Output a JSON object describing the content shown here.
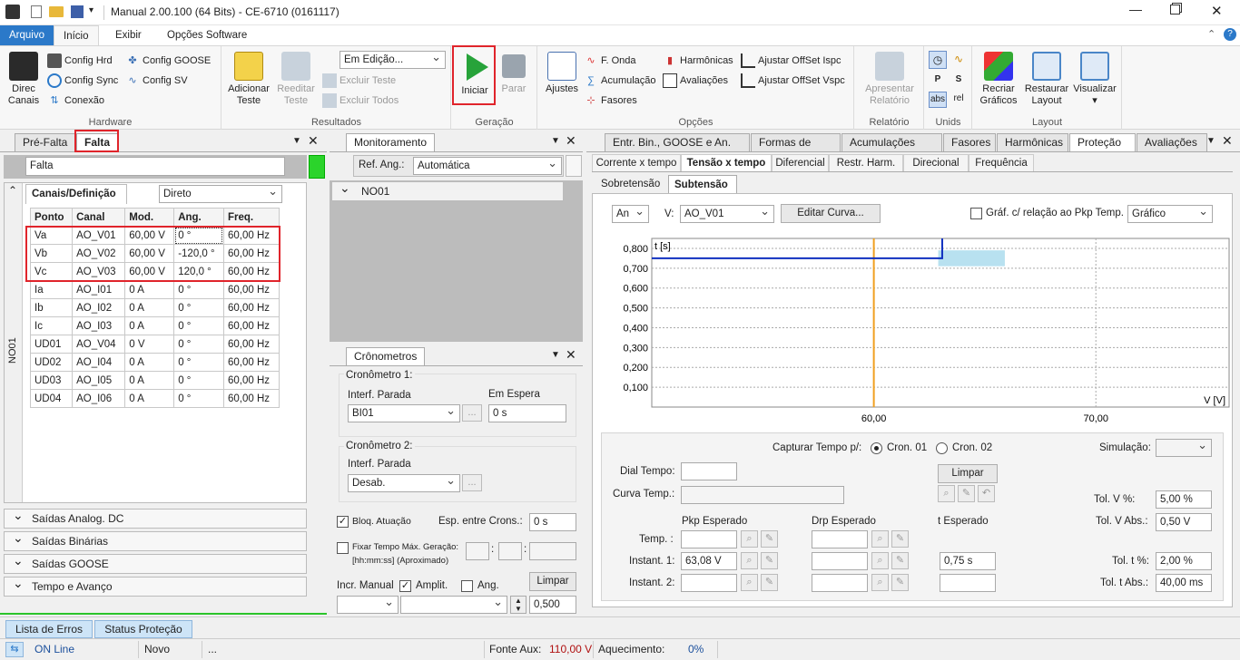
{
  "window": {
    "title": "Manual 2.00.100 (64 Bits) - CE-6710 (0161117)"
  },
  "menu": {
    "tabs": [
      "Arquivo",
      "Início",
      "Exibir",
      "Opções Software"
    ]
  },
  "ribbon": {
    "hardware": {
      "direc_canais": "Direc\nCanais",
      "config_hrd": "Config Hrd",
      "config_sync": "Config Sync",
      "conexao": "Conexão",
      "config_goose": "Config GOOSE",
      "config_sv": "Config SV",
      "label": "Hardware"
    },
    "resultados": {
      "adicionar": "Adicionar\nTeste",
      "reeditar": "Reeditar\nTeste",
      "status": "Em Edição...",
      "excluir_teste": "Excluir Teste",
      "excluir_todos": "Excluir Todos",
      "label": "Resultados"
    },
    "geracao": {
      "iniciar": "Iniciar",
      "parar": "Parar",
      "label": "Geração"
    },
    "opcoes": {
      "ajustes": "Ajustes",
      "f_onda": "F. Onda",
      "acumulacao": "Acumulação",
      "fasores": "Fasores",
      "harmonicas": "Harmônicas",
      "avaliacoes": "Avaliações",
      "offset_ispc": "Ajustar OffSet Ispc",
      "offset_vspc": "Ajustar OffSet Vspc",
      "label": "Opções"
    },
    "relatorio": {
      "apresentar": "Apresentar\nRelatório",
      "label": "Relatório"
    },
    "unids": {
      "abs": "abs",
      "rel": "rel",
      "label": "Unids"
    },
    "layout": {
      "recriar": "Recriar\nGráficos",
      "restaurar": "Restaurar\nLayout",
      "visualizar": "Visualizar",
      "label": "Layout"
    }
  },
  "left": {
    "tabs": [
      "Pré-Falta",
      "Falta"
    ],
    "name_field": "Falta",
    "side_label": "NO01",
    "sub_tab": "Canais/Definição",
    "mode": "Direto",
    "columns": [
      "Ponto",
      "Canal",
      "Mod.",
      "Ang.",
      "Freq."
    ],
    "rows": [
      [
        "Va",
        "AO_V01",
        "60,00 V",
        "0 °",
        "60,00 Hz"
      ],
      [
        "Vb",
        "AO_V02",
        "60,00 V",
        "-120,0 °",
        "60,00 Hz"
      ],
      [
        "Vc",
        "AO_V03",
        "60,00 V",
        "120,0 °",
        "60,00 Hz"
      ],
      [
        "Ia",
        "AO_I01",
        "0 A",
        "0 °",
        "60,00 Hz"
      ],
      [
        "Ib",
        "AO_I02",
        "0 A",
        "0 °",
        "60,00 Hz"
      ],
      [
        "Ic",
        "AO_I03",
        "0 A",
        "0 °",
        "60,00 Hz"
      ],
      [
        "UD01",
        "AO_V04",
        "0 V",
        "0 °",
        "60,00 Hz"
      ],
      [
        "UD02",
        "AO_I04",
        "0 A",
        "0 °",
        "60,00 Hz"
      ],
      [
        "UD03",
        "AO_I05",
        "0 A",
        "0 °",
        "60,00 Hz"
      ],
      [
        "UD04",
        "AO_I06",
        "0 A",
        "0 °",
        "60,00 Hz"
      ]
    ],
    "sections": [
      "Saídas Analog. DC",
      "Saídas Binárias",
      "Saídas GOOSE",
      "Tempo e Avanço"
    ]
  },
  "monitor": {
    "tab": "Monitoramento",
    "ref_label": "Ref. Ang.:",
    "ref_value": "Automática",
    "node": "NO01"
  },
  "crono": {
    "tab": "Crônometros",
    "c1": {
      "title": "Cronômetro 1:",
      "interf_label": "Interf. Parada",
      "interf_value": "BI01",
      "status_label": "Em Espera",
      "status_value": "0 s"
    },
    "c2": {
      "title": "Cronômetro 2:",
      "interf_label": "Interf. Parada",
      "interf_value": "Desab."
    },
    "bloq": "Bloq. Atuação",
    "esp_label": "Esp. entre Crons.:",
    "esp_value": "0 s",
    "fixar": "Fixar Tempo Máx. Geração:",
    "fixar_hint": "[hh:mm:ss] (Aproximado)",
    "limpar": "Limpar",
    "incr": "Incr. Manual",
    "amplit": "Amplit.",
    "ang": "Ang.",
    "step": "0,500"
  },
  "right": {
    "tabs": [
      "Entr. Bin., GOOSE e An. DC",
      "Formas de Onda",
      "Acumulações",
      "Fasores",
      "Harmônicas",
      "Proteção",
      "Avaliações"
    ],
    "subtabs": [
      "Corrente x tempo",
      "Tensão x tempo",
      "Diferencial",
      "Restr. Harm.",
      "Direcional",
      "Frequência"
    ],
    "subsub": [
      "Sobretensão",
      "Subtensão"
    ],
    "an": "An",
    "v_label": "V:",
    "v_value": "AO_V01",
    "editar": "Editar Curva...",
    "graf_rel": "Gráf. c/ relação ao Pkp Temp.",
    "graf_mode": "Gráfico",
    "capturar": "Capturar Tempo p/:",
    "cron01": "Cron. 01",
    "cron02": "Cron. 02",
    "simulacao": "Simulação:",
    "dial": "Dial Tempo:",
    "curva": "Curva Temp.:",
    "limpar": "Limpar",
    "pkp": "Pkp Esperado",
    "drp": "Drp Esperado",
    "t_esp": "t Esperado",
    "temp": "Temp. :",
    "inst1": "Instant. 1:",
    "inst2": "Instant. 2:",
    "inst1_pkp": "63,08 V",
    "inst1_t": "0,75 s",
    "tolv_pct_label": "Tol. V %:",
    "tolv_pct": "5,00 %",
    "tolv_abs_label": "Tol. V Abs.:",
    "tolv_abs": "0,50 V",
    "tolt_pct_label": "Tol. t %:",
    "tolt_pct": "2,00 %",
    "tolt_abs_label": "Tol. t Abs.:",
    "tolt_abs": "40,00 ms"
  },
  "chart_data": {
    "type": "line",
    "ylabel": "t [s]",
    "xlabel": "V [V]",
    "yticks": [
      "0,800",
      "0,700",
      "0,600",
      "0,500",
      "0,400",
      "0,300",
      "0,200",
      "0,100"
    ],
    "xticks": [
      "60,00",
      "70,00"
    ],
    "ylim": [
      0,
      0.85
    ],
    "xlim": [
      50,
      76
    ],
    "series": [
      {
        "x": [
          50,
          63.08,
          63.08
        ],
        "y": [
          0.75,
          0.75,
          0.85
        ]
      }
    ],
    "marker_x": 60,
    "tolerance_band": {
      "x": [
        62.9,
        65.9
      ],
      "y": [
        0.71,
        0.79
      ]
    },
    "colors": {
      "curve": "#1030c0",
      "marker": "#f0a020",
      "band": "#7ec8e3"
    }
  },
  "bottom": {
    "tabs": [
      "Lista de Erros",
      "Status Proteção"
    ]
  },
  "status": {
    "online": "ON Line",
    "mode": "Novo",
    "dots": "...",
    "fonte_label": "Fonte Aux:",
    "fonte_value": "110,00 V",
    "aquec_label": "Aquecimento:",
    "aquec_value": "0%"
  }
}
